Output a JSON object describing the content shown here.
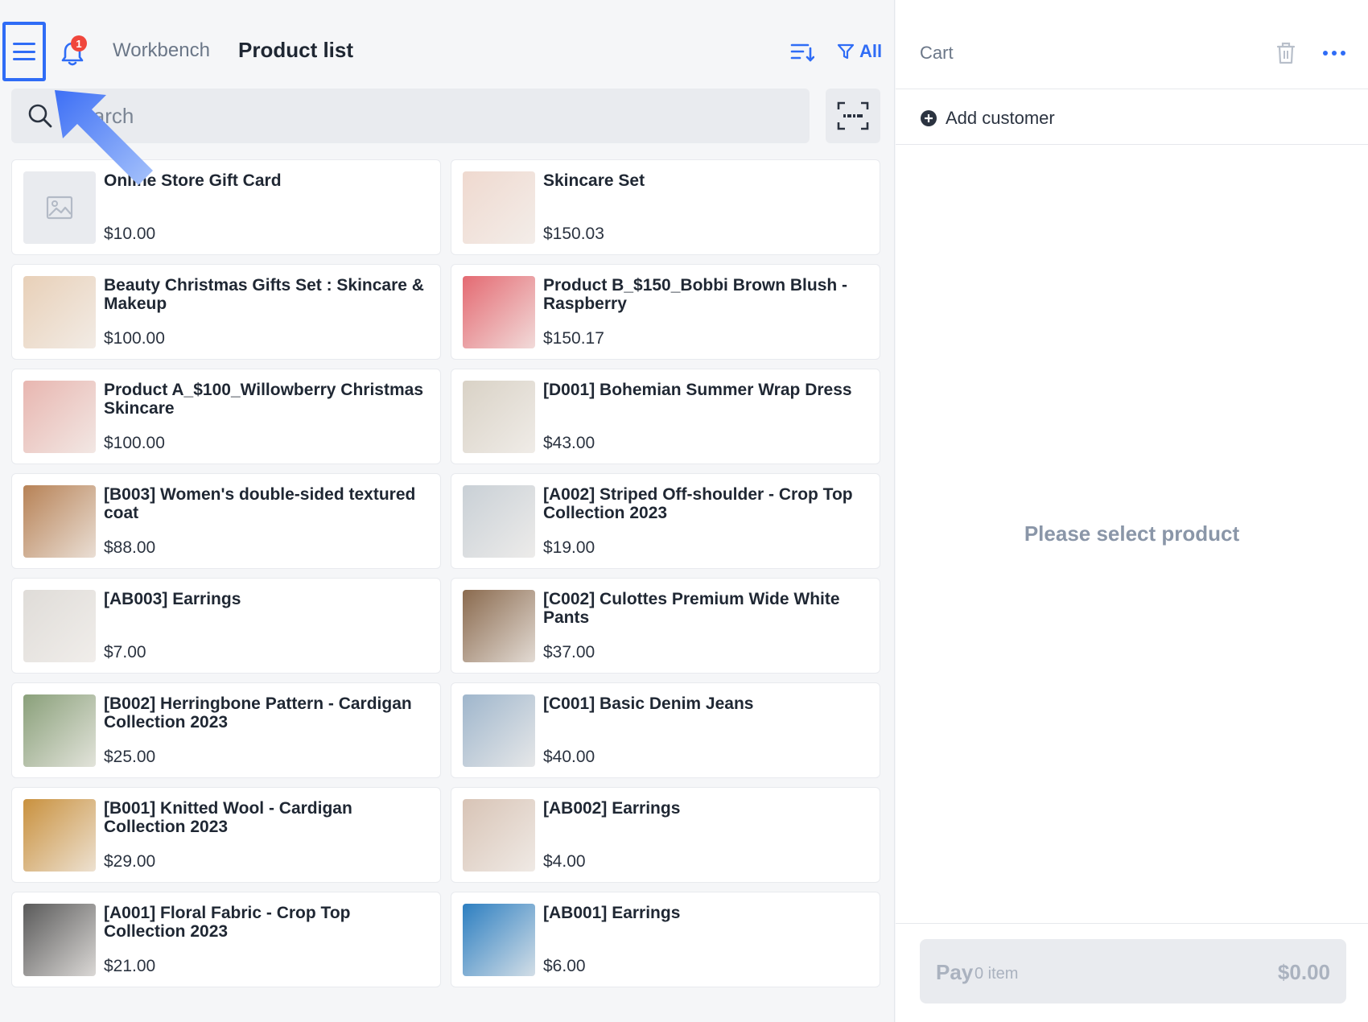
{
  "header": {
    "notification_count": "1",
    "tab_workbench": "Workbench",
    "tab_product_list": "Product list",
    "filter_label": "All"
  },
  "search": {
    "placeholder": "Search"
  },
  "products": [
    {
      "name": "Online Store Gift Card",
      "price": "$10.00",
      "image": "placeholder",
      "color": "#e9ebef"
    },
    {
      "name": "Skincare Set",
      "price": "$150.03",
      "image": "photo",
      "color": "#efd9cf"
    },
    {
      "name": "Beauty Christmas Gifts Set : Skincare & Makeup",
      "price": "$100.00",
      "image": "photo",
      "color": "#e8d0b8"
    },
    {
      "name": "Product B_$150_Bobbi Brown Blush - Raspberry",
      "price": "$150.17",
      "image": "photo",
      "color": "#e46a72"
    },
    {
      "name": "Product A_$100_Willowberry Christmas Skincare",
      "price": "$100.00",
      "image": "photo",
      "color": "#e8b6b0"
    },
    {
      "name": "[D001] Bohemian Summer Wrap Dress",
      "price": "$43.00",
      "image": "photo",
      "color": "#d9d2c6"
    },
    {
      "name": "[B003] Women's double-sided textured coat",
      "price": "$88.00",
      "image": "photo",
      "color": "#b78256"
    },
    {
      "name": "[A002] Striped Off-shoulder - Crop Top Collection 2023",
      "price": "$19.00",
      "image": "photo",
      "color": "#c9d0d6"
    },
    {
      "name": "[AB003] Earrings",
      "price": "$7.00",
      "image": "photo",
      "color": "#dfdcd8"
    },
    {
      "name": "[C002] Culottes Premium Wide White Pants",
      "price": "$37.00",
      "image": "photo",
      "color": "#8a6a4e"
    },
    {
      "name": "[B002] Herringbone Pattern - Cardigan Collection 2023",
      "price": "$25.00",
      "image": "photo",
      "color": "#8aa07a"
    },
    {
      "name": "[C001] Basic Denim Jeans",
      "price": "$40.00",
      "image": "photo",
      "color": "#9fb6cc"
    },
    {
      "name": "[B001] Knitted Wool - Cardigan Collection 2023",
      "price": "$29.00",
      "image": "photo",
      "color": "#c9913e"
    },
    {
      "name": "[AB002] Earrings",
      "price": "$4.00",
      "image": "photo",
      "color": "#d8c4b6"
    },
    {
      "name": "[A001] Floral Fabric - Crop Top Collection 2023",
      "price": "$21.00",
      "image": "photo",
      "color": "#5a5a5a"
    },
    {
      "name": "[AB001] Earrings",
      "price": "$6.00",
      "image": "photo",
      "color": "#2d7fc1"
    }
  ],
  "cart": {
    "title": "Cart",
    "add_customer": "Add customer",
    "empty_message": "Please select product",
    "pay_label": "Pay",
    "pay_count": "0 item",
    "pay_total": "$0.00"
  },
  "colors": {
    "accent": "#2f6cf6",
    "badge": "#f0463c"
  }
}
